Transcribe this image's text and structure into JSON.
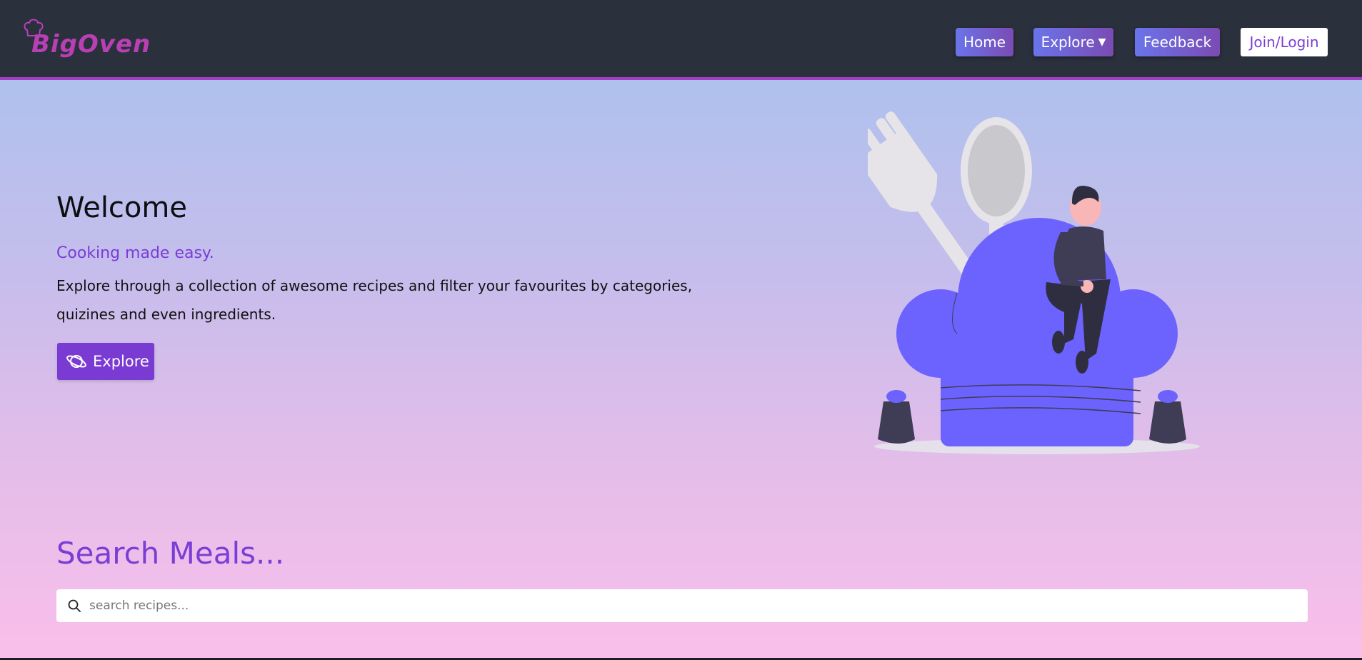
{
  "brand": {
    "name": "BigOven"
  },
  "nav": {
    "home": "Home",
    "explore": "Explore",
    "feedback": "Feedback",
    "login": "Join/Login"
  },
  "hero": {
    "title": "Welcome",
    "tagline": "Cooking made easy.",
    "description": "Explore through a collection of awesome recipes and filter your favourites by categories, quizines and even ingredients.",
    "cta_label": "Explore"
  },
  "search": {
    "title": "Search Meals...",
    "placeholder": "search recipes..."
  },
  "icons": {
    "logo": "chef-hat-icon",
    "nav_dropdown": "caret-down-icon",
    "cta": "planet-icon",
    "search": "search-icon"
  },
  "colors": {
    "navbar": "#2b303d",
    "accent": "#7a3dd6",
    "nav_gradient_start": "#6a74ea",
    "nav_gradient_end": "#7b4bb3",
    "hat": "#6c63ff"
  }
}
